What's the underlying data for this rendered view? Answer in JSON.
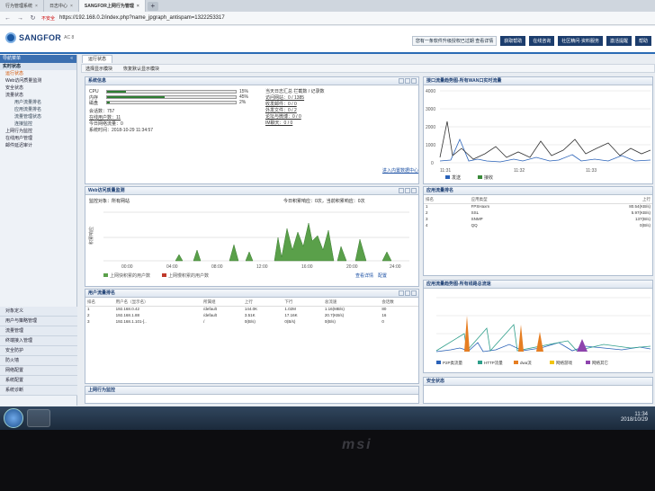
{
  "browser": {
    "tabs": [
      {
        "label": "行为管理系统"
      },
      {
        "label": "日志中心"
      },
      {
        "label": "SANGFOR上网行为管理",
        "active": true
      }
    ],
    "url_warning": "不安全",
    "url": "https://192.168.0.2/index.php?name_jpgraph_antispam=1322253317"
  },
  "header": {
    "brand": "SANGFOR",
    "product": "AC 8",
    "buttons": [
      "您有一条软件升级授权已过期 查看详情",
      "获取帮助",
      "在线咨询",
      "社区精问·资料服务",
      "激活提醒",
      "帮助"
    ]
  },
  "sidebar": {
    "title": "导航菜单",
    "collapse": "«",
    "items": [
      {
        "label": "实时状态",
        "type": "sec"
      },
      {
        "label": "运行状态",
        "type": "sel"
      },
      {
        "label": "Web访问质量监测",
        "type": "item"
      },
      {
        "label": "安全状态",
        "type": "item"
      },
      {
        "label": "流量状态",
        "type": "item"
      },
      {
        "label": "用户流量排名",
        "type": "sub"
      },
      {
        "label": "应用流量排名",
        "type": "sub"
      },
      {
        "label": "流量管理状态",
        "type": "sub"
      },
      {
        "label": "连接监控",
        "type": "sub"
      },
      {
        "label": "上网行为监控",
        "type": "item"
      },
      {
        "label": "在线用户管理",
        "type": "item"
      },
      {
        "label": "邮件延迟审计",
        "type": "item"
      }
    ],
    "bottom": [
      "对象定义",
      "用户与策略管理",
      "流量管理",
      "终端接入管理",
      "安全防护",
      "防火墙",
      "网络配置",
      "系统配置",
      "系统诊断"
    ]
  },
  "main": {
    "tab": "运行状态",
    "toolbar": [
      "选择显示模块",
      "恢复默认显示模块"
    ],
    "system_info": {
      "title": "系统信息",
      "resources": [
        {
          "label": "CPU",
          "percent": 15,
          "text": "15%"
        },
        {
          "label": "内存",
          "percent": 45,
          "text": "45%"
        },
        {
          "label": "磁盘",
          "percent": 2,
          "text": "2%"
        }
      ],
      "left": [
        "会话数：757",
        "在线用户数：11",
        "今日网络流量：0",
        "系统时间：2018-10-29 11:34:57"
      ],
      "right": [
        "当天日志汇总  拦截数 / 记录数",
        "访问网站：0 / 1385",
        "收发邮件：0 / 0",
        "外发文件：0 / 2",
        "论坛与微博：0 / 0",
        "IM聊天：0 / 0"
      ],
      "link": "进入内置数据中心"
    },
    "wan_chart": {
      "title": "接口流量趋势图-所有WAN口实时流量",
      "y_ticks": [
        "4000",
        "3000",
        "2000",
        "1000",
        "0"
      ],
      "x_ticks": [
        "11:31",
        "11:32",
        "11:33"
      ],
      "legend": [
        "发送",
        "接收"
      ]
    },
    "web_monitor": {
      "title": "Web访问质量监测",
      "filter": "监控对象：所有网站",
      "summary": "今日积累响应：0次，当前积累响应：0次",
      "y_label": "积累响应",
      "x_ticks": [
        "00:00",
        "04:00",
        "08:00",
        "12:00",
        "16:00",
        "20:00",
        "24:00"
      ],
      "legend": [
        "上网快积累的用户数",
        "上网慢积累的用户数"
      ],
      "links": [
        "查看详情",
        "配置"
      ]
    },
    "app_rank": {
      "title": "应用流量排名",
      "headers": [
        "排名",
        "应用类型",
        "上行"
      ],
      "rows": [
        [
          "1",
          "FPSHaxm",
          "80.54(KB/s)"
        ],
        [
          "2",
          "SSL",
          "5.97(KB/s)"
        ],
        [
          "3",
          "SNMP",
          "137(B/s)"
        ],
        [
          "4",
          "QQ",
          "0(B/s)"
        ]
      ]
    },
    "user_rank": {
      "title": "用户流量排名",
      "headers": [
        "排名",
        "用户名（显示名）",
        "所属组",
        "上行",
        "下行",
        "总流速",
        "会话数"
      ],
      "rows": [
        [
          "1",
          "192.168.0.42",
          "/default",
          "144.0K",
          "1.02M",
          "1.16(MB/s)",
          "80"
        ],
        [
          "2",
          "192.168.1.88",
          "/default",
          "3.51K",
          "17.16K",
          "20.7(KB/s)",
          "16"
        ],
        [
          "3",
          "192.168.1.101-[..",
          "/",
          "0(B/s)",
          "0(B/s)",
          "0(B/s)",
          "0"
        ]
      ]
    },
    "app_trend": {
      "title": "应用流量趋势图-所有线路总流速",
      "legend": [
        "P2P类流量",
        "HTTP流量",
        "dwa流",
        "网络游戏",
        "网络其它"
      ]
    },
    "behavior": {
      "title": "上网行为监控"
    },
    "security": {
      "title": "安全状态"
    }
  },
  "taskbar": {
    "time": "11:34",
    "date": "2018/10/29"
  },
  "bezel": {
    "brand": "msi"
  }
}
